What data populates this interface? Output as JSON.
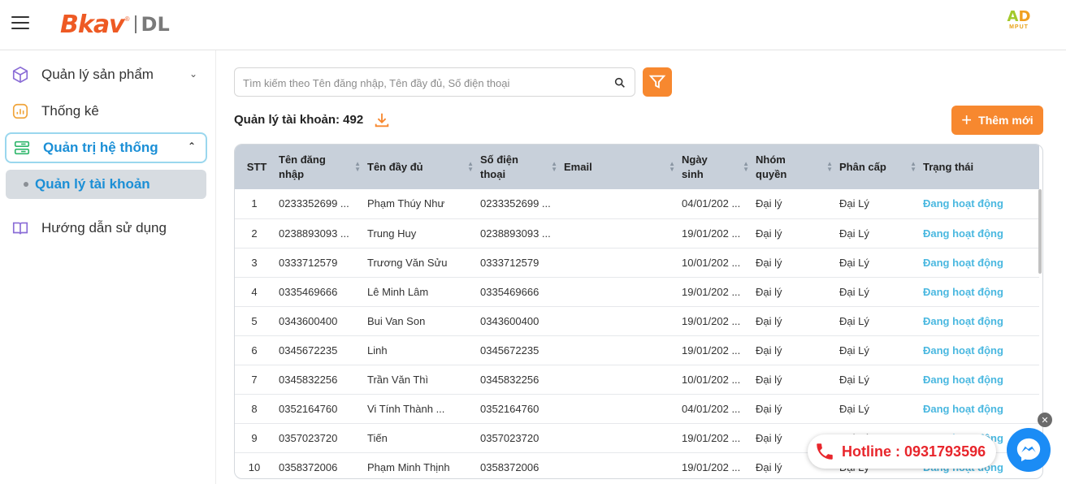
{
  "header": {
    "logo_main": "Bkav",
    "logo_sub": "DL",
    "brand_right_top": "AD",
    "brand_right_bottom": "MPUT"
  },
  "sidebar": {
    "items": [
      {
        "label": "Quản lý sản phẩm",
        "icon": "cube-icon"
      },
      {
        "label": "Thống kê",
        "icon": "chart-icon"
      },
      {
        "label": "Quản trị hệ thống",
        "icon": "server-icon"
      },
      {
        "label": "Quản lý tài khoản"
      },
      {
        "label": "Hướng dẫn sử dụng",
        "icon": "book-icon"
      }
    ]
  },
  "search": {
    "placeholder": "Tìm kiếm theo Tên đăng nhập, Tên đầy đủ, Số điện thoại"
  },
  "page": {
    "title": "Quản lý tài khoản: 492",
    "add_button": "Thêm mới"
  },
  "table": {
    "columns": [
      "STT",
      "Tên đăng nhập",
      "Tên đầy đủ",
      "Số điện thoại",
      "Email",
      "Ngày sinh",
      "Nhóm quyền",
      "Phân cấp",
      "Trạng thái"
    ],
    "rows": [
      [
        "1",
        "0233352699 ...",
        "Phạm Thúy Như",
        "0233352699 ...",
        "",
        "04/01/202 ...",
        "Đại lý",
        "Đại Lý",
        "Đang hoạt động"
      ],
      [
        "2",
        "0238893093 ...",
        "Trung Huy",
        "0238893093 ...",
        "",
        "19/01/202 ...",
        "Đại lý",
        "Đại Lý",
        "Đang hoạt động"
      ],
      [
        "3",
        "0333712579",
        "Trương Văn Sửu",
        "0333712579",
        "",
        "10/01/202 ...",
        "Đại lý",
        "Đại Lý",
        "Đang hoạt động"
      ],
      [
        "4",
        "0335469666",
        "Lê Minh Lâm",
        "0335469666",
        "",
        "19/01/202 ...",
        "Đại lý",
        "Đại Lý",
        "Đang hoạt động"
      ],
      [
        "5",
        "0343600400",
        "Bui Van Son",
        "0343600400",
        "",
        "19/01/202 ...",
        "Đại lý",
        "Đại Lý",
        "Đang hoạt động"
      ],
      [
        "6",
        "0345672235",
        "Linh",
        "0345672235",
        "",
        "19/01/202 ...",
        "Đại lý",
        "Đại Lý",
        "Đang hoạt động"
      ],
      [
        "7",
        "0345832256",
        "Trần Văn Thì",
        "0345832256",
        "",
        "10/01/202 ...",
        "Đại lý",
        "Đại Lý",
        "Đang hoạt động"
      ],
      [
        "8",
        "0352164760",
        "Vi Tính Thành ...",
        "0352164760",
        "",
        "04/01/202 ...",
        "Đại lý",
        "Đại Lý",
        "Đang hoạt động"
      ],
      [
        "9",
        "0357023720",
        "Tiến",
        "0357023720",
        "",
        "19/01/202 ...",
        "Đại lý",
        "Đại Lý",
        "Đang hoạt động"
      ],
      [
        "10",
        "0358372006",
        "Phạm Minh Thịnh",
        "0358372006",
        "",
        "19/01/202 ...",
        "Đại lý",
        "Đại Lý",
        "Đang hoạt động"
      ]
    ]
  },
  "hotline": {
    "label": "Hotline : 0931793596"
  },
  "colors": {
    "accent": "#f7882f",
    "active_blue": "#1b8fd6",
    "status": "#4ab8e0",
    "header_row": "#c8d0da"
  }
}
